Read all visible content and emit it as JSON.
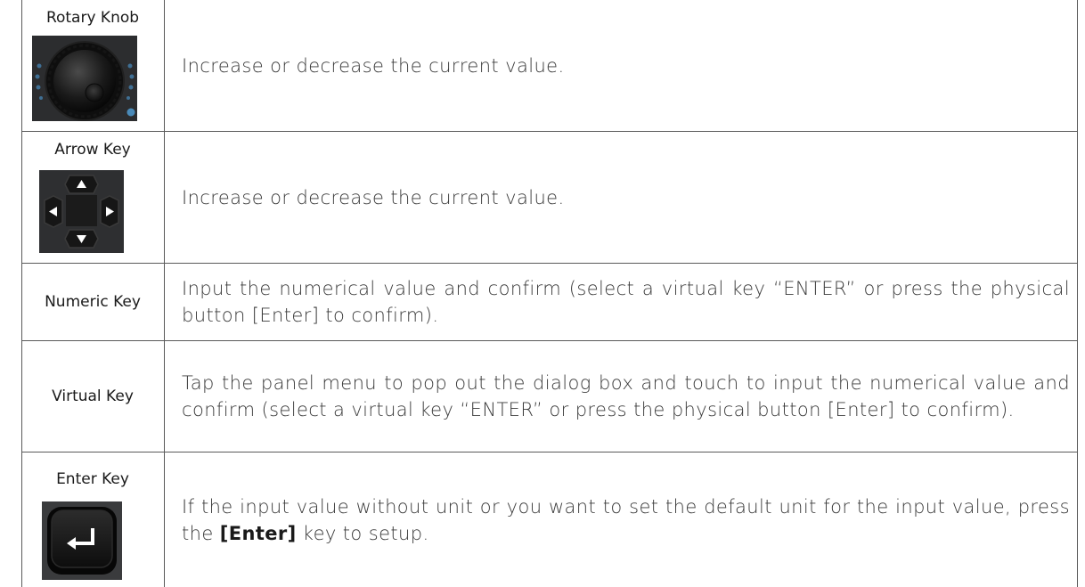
{
  "rows": [
    {
      "label": "Rotary Knob",
      "description": "Increase or decrease the current value.",
      "image_icon": "rotary-knob-image"
    },
    {
      "label": "Arrow Key",
      "description": "Increase or decrease the current value.",
      "image_icon": "arrow-key-pad-image"
    },
    {
      "label": "Numeric Key",
      "description": "Input the numerical value and confirm (select a virtual key “ENTER” or press the physical button [Enter] to confirm)."
    },
    {
      "label": "Virtual Key",
      "description": "Tap the panel menu to pop out the dialog box and touch to input the numerical value and confirm (select a virtual key “ENTER” or press the physical button [Enter] to confirm)."
    },
    {
      "label": "Enter Key",
      "description_before": "If the input value without unit or you want to set the default unit for the input value, press the ",
      "description_key": "[Enter]",
      "description_after": " key to setup.",
      "image_icon": "enter-key-image"
    }
  ],
  "colors": {
    "border": "#5a5a5a",
    "key_body": "#1e1e1e",
    "knob_led": "#4a8ab8"
  }
}
